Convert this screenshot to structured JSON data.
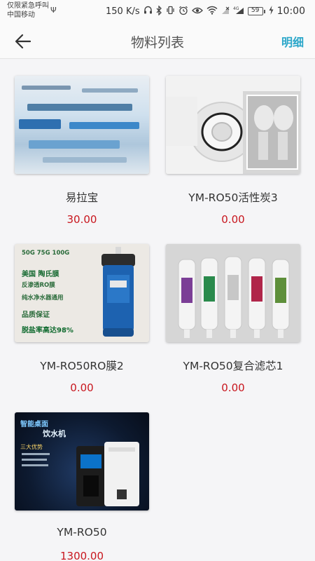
{
  "status_bar": {
    "carrier_line1": "仅限紧急呼叫",
    "carrier_line2": "中国移动",
    "network_speed": "150 K/s",
    "battery": "59",
    "time": "10:00",
    "icons": [
      "usb-icon",
      "headset-icon",
      "bluetooth-icon",
      "vibrate-icon",
      "alarm-icon",
      "eye-icon",
      "wifi-icon",
      "no-signal-icon",
      "4g-signal-icon",
      "battery-icon",
      "charging-icon"
    ]
  },
  "nav": {
    "title": "物料列表",
    "action": "明细",
    "back_icon": "arrow-left-icon"
  },
  "products": [
    {
      "name": "易拉宝",
      "price": "30.00"
    },
    {
      "name": "YM-RO50活性炭3",
      "price": "0.00"
    },
    {
      "name": "YM-RO50RO膜2",
      "price": "0.00"
    },
    {
      "name": "YM-RO50复合滤芯1",
      "price": "0.00"
    },
    {
      "name": "YM-RO50",
      "price": "1300.00"
    }
  ],
  "thumb_text": {
    "membrane_line1": "50G 75G 100G",
    "membrane_line2": "美国 陶氏膜",
    "membrane_line3": "反渗透RO膜",
    "membrane_line4": "纯水净水器通用",
    "membrane_line5": "品质保证",
    "membrane_line6": "脱盐率高达98%",
    "machine_line1": "智能桌面",
    "machine_line2": "饮水机",
    "machine_line3": "三大优势"
  },
  "colors": {
    "accent": "#2aa6c9",
    "price": "#c8161e"
  }
}
